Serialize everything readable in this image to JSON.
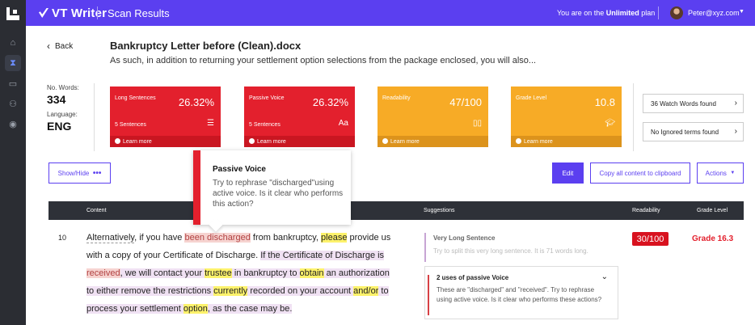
{
  "app": {
    "name": "VT Writer",
    "page": "Scan Results",
    "plan_prefix": "You are on the ",
    "plan_name": "Unlimited",
    "plan_suffix": " plan",
    "user": "Peter@xyz.com"
  },
  "header": {
    "back_label": "Back",
    "doc_title": "Bankruptcy Letter before (Clean).docx",
    "excerpt": "As such, in addition to returning your settlement option selections from the package enclosed, you will also..."
  },
  "stats": {
    "words_label": "No. Words:",
    "words_value": "334",
    "language_label": "Language:",
    "language_value": "ENG"
  },
  "cards": [
    {
      "name": "Long Sentences",
      "value": "26.32%",
      "sub": "5 Sentences",
      "icon": "list-icon",
      "learn": "Learn more",
      "color": "#e3202d"
    },
    {
      "name": "Passive Voice",
      "value": "26.32%",
      "sub": "5 Sentences",
      "icon": "text-aa-icon",
      "learn": "Learn more",
      "color": "#e3202d"
    },
    {
      "name": "Readability",
      "value": "47/100",
      "sub": "",
      "icon": "book-icon",
      "learn": "Learn more",
      "color": "#f7ab26"
    },
    {
      "name": "Grade Level",
      "value": "10.8",
      "sub": "",
      "icon": "graduation-cap-icon",
      "learn": "Learn more",
      "color": "#f7ab26"
    }
  ],
  "side_links": {
    "watch_words": "36 Watch Words found",
    "ignored": "No Ignored terms found"
  },
  "toolbar": {
    "show_hide": "Show/Hide",
    "edit": "Edit",
    "copy": "Copy all content to clipboard",
    "actions": "Actions"
  },
  "table": {
    "headers": {
      "content": "Content",
      "suggestions": "Suggestions",
      "readability": "Readability",
      "grade": "Grade Level"
    },
    "row": {
      "number": "10",
      "readability": "30/100",
      "grade": "Grade 16.3",
      "text": {
        "w1": "Alternatively",
        "w2": ", if you have ",
        "w3": "been discharged",
        "w4": " from bankruptcy, ",
        "w5": "please",
        "w6": " provide us with a copy of your Certificate of Discharge.  ",
        "w7": "If the Certificate of Discharge is ",
        "w8": "received",
        "w9": ", we will contact your ",
        "w10": "trustee",
        "w11": " in bankruptcy to ",
        "w12": "obtain",
        "w13": " an authorization to either remove the restrictions ",
        "w14": "currently",
        "w15": " recorded on your account ",
        "w16": "and/or",
        "w17": " to process your settlement ",
        "w18": "option",
        "w19": ", as the case may be."
      }
    }
  },
  "suggestions": [
    {
      "title": "Very Long Sentence",
      "desc": "Try to split this very long sentence. It is 71 words long."
    },
    {
      "title": "2 uses of passive Voice",
      "desc": "These are \"discharged\" and \"received\". Try to rephrase using active voice. Is it clear who performs these actions?"
    }
  ],
  "tooltip": {
    "title": "Passive Voice",
    "desc": "Try to rephrase \"discharged\"using active voice. Is it clear who performs this action?"
  }
}
